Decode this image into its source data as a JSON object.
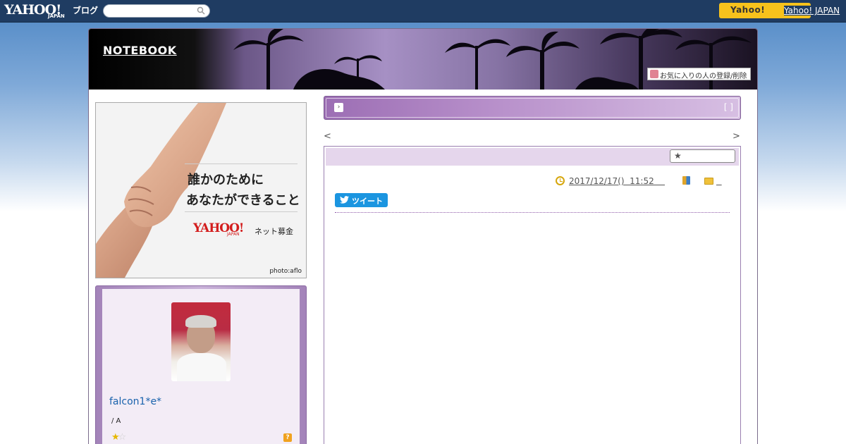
{
  "topbar": {
    "logo_main": "YAHOO!",
    "logo_sub": "JAPAN",
    "logo_blog": "ブログ",
    "search_placeholder": "",
    "yahoo_button": "Yahoo!",
    "yahoo_link": "Yahoo! JAPAN"
  },
  "header": {
    "blog_title": "NOTEBOOK",
    "favorite_button": "お気に入りの人の登録/削除"
  },
  "ad": {
    "line1": "誰かのために",
    "line2": "あなたができること",
    "brand": "YAHOO!",
    "brand_sub": "JAPAN",
    "service": "ネット募金",
    "credit": "photo:aflo"
  },
  "profile": {
    "username": "falcon1*e*",
    "info": "/ A",
    "stars_on": "★",
    "stars_off": "☆",
    "help": "?"
  },
  "category_bar": {
    "arrow": "›",
    "brackets": "[ ]"
  },
  "nav": {
    "prev": "<",
    "next": ">"
  },
  "article": {
    "favorite_star": "★",
    "date": "2017/12/17()  11:52    ",
    "folder_link": "  ",
    "tweet_label": "ツイート"
  },
  "colors": {
    "topbar": "#1f3c62",
    "yahoo_button": "#f7c21c",
    "accent_purple": "#9c6eb4",
    "tweet_blue": "#1b95e0"
  }
}
